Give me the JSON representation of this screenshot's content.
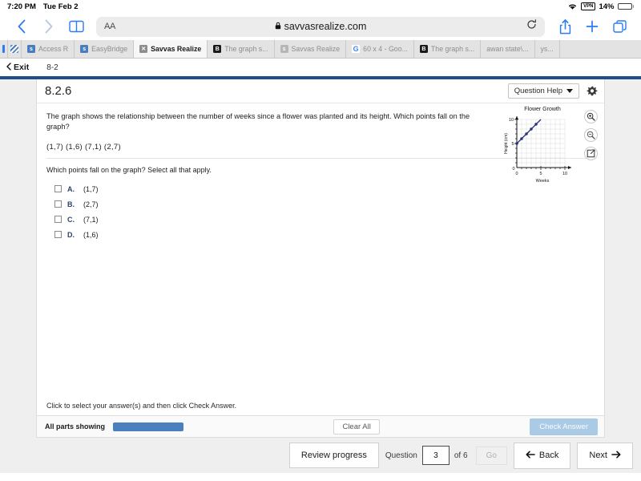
{
  "status_bar": {
    "time": "7:20 PM",
    "date": "Tue Feb 2",
    "vpn_label": "VPN",
    "battery_percent": "14%",
    "battery_level": 14,
    "wifi_icon": "wifi-icon"
  },
  "browser": {
    "back_icon": "back-chevron-icon",
    "forward_icon": "forward-chevron-icon",
    "bookmarks_icon": "book-icon",
    "text_size_label": "AA",
    "lock_icon": "lock-icon",
    "url": "savvasrealize.com",
    "reload_icon": "reload-icon",
    "share_icon": "share-icon",
    "new_tab_icon": "plus-icon",
    "tabs_icon": "tab-overview-icon",
    "tabs": [
      {
        "label": "",
        "favicon": "bar-icon",
        "active": false,
        "sliver": true
      },
      {
        "label": "",
        "favicon": "stripe-icon",
        "active": false,
        "sliver": true
      },
      {
        "label": "Access R",
        "favicon": "savvas-icon",
        "active": false,
        "sliver": false
      },
      {
        "label": "EasyBridge",
        "favicon": "savvas-icon",
        "active": false,
        "sliver": false
      },
      {
        "label": "Savvas Realize",
        "favicon": "x-icon",
        "active": true,
        "sliver": false
      },
      {
        "label": "The graph s...",
        "favicon": "brainly-icon",
        "active": false,
        "sliver": false
      },
      {
        "label": "Savvas Realize",
        "favicon": "savvas-gray-icon",
        "active": false,
        "sliver": false
      },
      {
        "label": "60 x 4 - Goo...",
        "favicon": "google-icon",
        "active": false,
        "sliver": false
      },
      {
        "label": "The graph s...",
        "favicon": "brainly-icon",
        "active": false,
        "sliver": false
      },
      {
        "label": "awan state\\...",
        "favicon": "none",
        "active": false,
        "sliver": false
      },
      {
        "label": "ys...",
        "favicon": "none",
        "active": false,
        "sliver": false
      }
    ]
  },
  "app": {
    "exit_label": "Exit",
    "exit_icon": "chevron-left-icon",
    "lesson": "8-2",
    "question_number": "8.2.6",
    "question_help_label": "Question Help",
    "question_help_caret": "chevron-down-icon",
    "settings_icon": "gear-icon",
    "accent_color": "#1f4e8c"
  },
  "question": {
    "text": "The graph shows the relationship between the number of weeks since a flower was planted and its height. Which points fall on the graph?",
    "points_line": "(1,7)  (1,6)  (7,1)  (2,7)",
    "prompt": "Which points fall on the graph? Select all that apply.",
    "choices": [
      {
        "letter": "A.",
        "value": "(1,7)",
        "checked": false
      },
      {
        "letter": "B.",
        "value": "(2,7)",
        "checked": false
      },
      {
        "letter": "C.",
        "value": "(7,1)",
        "checked": false
      },
      {
        "letter": "D.",
        "value": "(1,6)",
        "checked": false
      }
    ],
    "hint": "Click to select your answer(s) and then click Check Answer."
  },
  "graph_tools": {
    "zoom_in_icon": "zoom-in-icon",
    "zoom_out_icon": "zoom-out-icon",
    "open_external_icon": "open-external-icon"
  },
  "card_footer": {
    "all_parts_label": "All parts showing",
    "progress_color": "#4a80bd",
    "progress_percent": 100,
    "clear_all_label": "Clear All",
    "check_answer_label": "Check Answer",
    "check_answer_color": "#6ba3d6",
    "check_answer_enabled": false
  },
  "bottom_nav": {
    "review_label": "Review progress",
    "question_label": "Question",
    "question_value": "3",
    "of_label": "of 6",
    "go_label": "Go",
    "go_enabled": false,
    "back_label": "Back",
    "back_icon": "arrow-left-icon",
    "next_label": "Next",
    "next_icon": "arrow-right-icon"
  },
  "chart_data": {
    "type": "line",
    "title": "Flower Growth",
    "xlabel": "Weeks",
    "ylabel": "Height (cm)",
    "x": [
      0,
      1,
      2,
      3,
      4
    ],
    "values": [
      5,
      6,
      7,
      8,
      9
    ],
    "xlim": [
      0,
      11
    ],
    "ylim": [
      0,
      11
    ],
    "xticks": [
      0,
      5,
      10
    ],
    "yticks": [
      0,
      5,
      10
    ],
    "grid": true,
    "legend": "none",
    "line_color": "#26317a",
    "point_color": "#26317a",
    "line_extends_to": [
      5,
      10
    ]
  }
}
